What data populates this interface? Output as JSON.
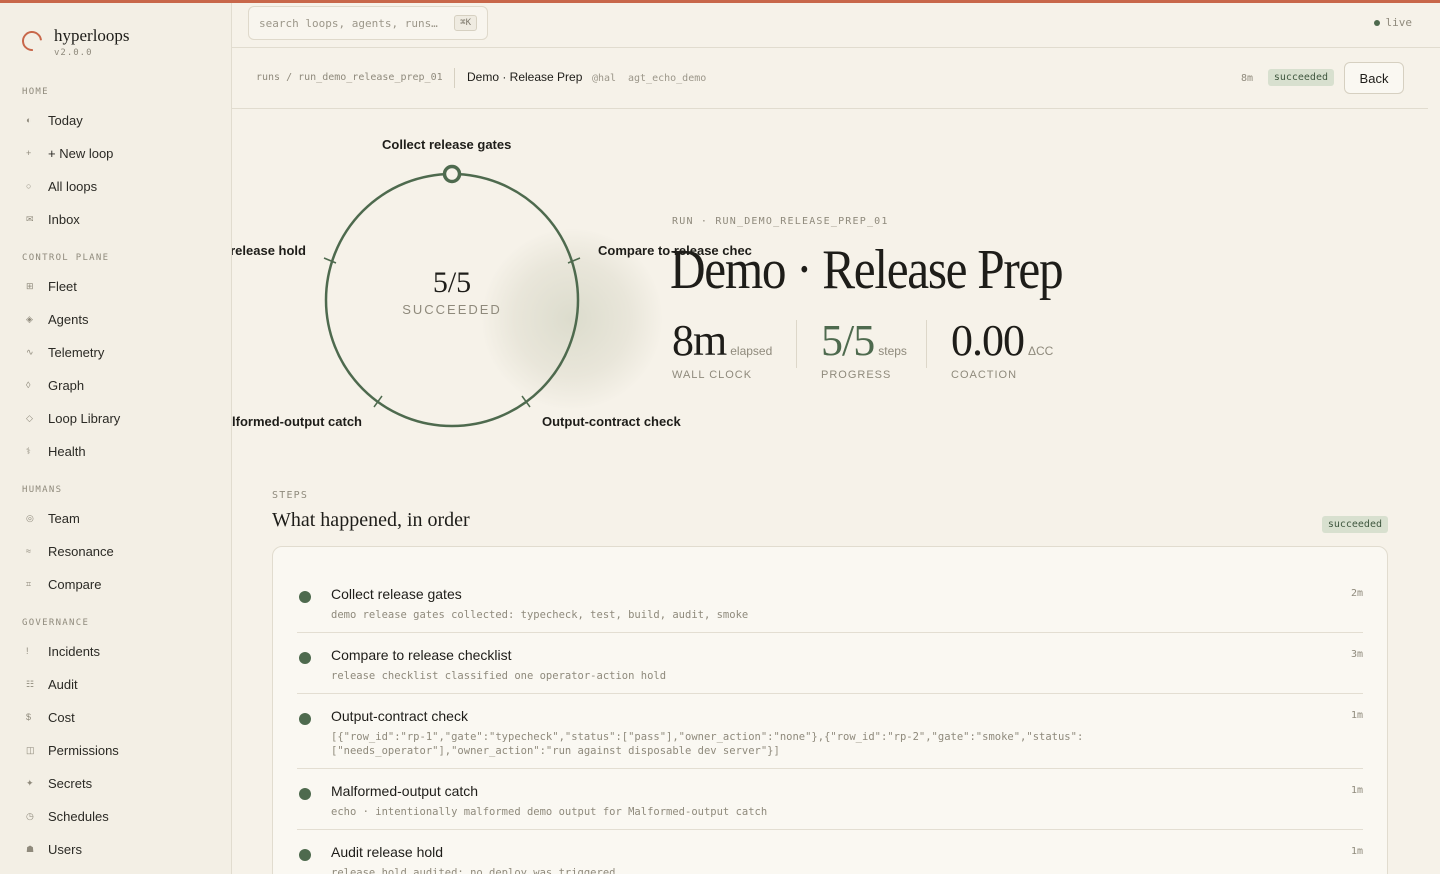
{
  "app": {
    "name": "hyperloops",
    "version": "v2.0.0"
  },
  "search": {
    "placeholder": "search loops, agents, runs…",
    "shortcut": "⌘K"
  },
  "status": {
    "live": "live"
  },
  "sidebar": {
    "sections": [
      {
        "label": "HOME",
        "items": [
          {
            "glyph": "◐",
            "label": "Today"
          },
          {
            "glyph": "+",
            "label": "+ New loop"
          },
          {
            "glyph": "○",
            "label": "All loops"
          },
          {
            "glyph": "✉",
            "label": "Inbox"
          }
        ]
      },
      {
        "label": "CONTROL PLANE",
        "items": [
          {
            "glyph": "⊞",
            "label": "Fleet"
          },
          {
            "glyph": "◈",
            "label": "Agents"
          },
          {
            "glyph": "∿",
            "label": "Telemetry"
          },
          {
            "glyph": "◊",
            "label": "Graph"
          },
          {
            "glyph": "◇",
            "label": "Loop Library"
          },
          {
            "glyph": "⚕",
            "label": "Health"
          }
        ]
      },
      {
        "label": "HUMANS",
        "items": [
          {
            "glyph": "◎",
            "label": "Team"
          },
          {
            "glyph": "≈",
            "label": "Resonance"
          },
          {
            "glyph": "⌗",
            "label": "Compare"
          }
        ]
      },
      {
        "label": "GOVERNANCE",
        "items": [
          {
            "glyph": "!",
            "label": "Incidents"
          },
          {
            "glyph": "☷",
            "label": "Audit"
          },
          {
            "glyph": "$",
            "label": "Cost"
          },
          {
            "glyph": "◫",
            "label": "Permissions"
          },
          {
            "glyph": "✦",
            "label": "Secrets"
          },
          {
            "glyph": "◷",
            "label": "Schedules"
          },
          {
            "glyph": "☗",
            "label": "Users"
          }
        ]
      }
    ]
  },
  "header": {
    "crumbs": [
      "runs",
      "run_demo_release_prep_01"
    ],
    "title": "Demo · Release Prep",
    "owner": "@hal",
    "agent": "agt_echo_demo",
    "duration": "8m",
    "status": "succeeded",
    "back_label": "Back"
  },
  "ring": {
    "count": "5/5",
    "state": "SUCCEEDED",
    "labels": [
      "Collect release gates",
      "Compare to release checklist",
      "Output-contract check",
      "Malformed-output catch",
      "Audit release hold"
    ],
    "completed_fraction": 1.0
  },
  "hero": {
    "eyebrow": "RUN · RUN_DEMO_RELEASE_PREP_01",
    "title": "Demo · Release Prep",
    "stats": [
      {
        "value": "8m",
        "unit": "elapsed",
        "label": "WALL CLOCK"
      },
      {
        "value": "5/5",
        "unit": "steps",
        "label": "PROGRESS"
      },
      {
        "value": "0.00",
        "unit": "ΔCC",
        "label": "COACTION"
      }
    ]
  },
  "steps": {
    "eyebrow": "STEPS",
    "title": "What happened, in order",
    "status": "succeeded",
    "items": [
      {
        "title": "Collect release gates",
        "detail": "demo release gates collected: typecheck, test, build, audit, smoke",
        "duration": "2m"
      },
      {
        "title": "Compare to release checklist",
        "detail": "release checklist classified one operator-action hold",
        "duration": "3m"
      },
      {
        "title": "Output-contract check",
        "detail": "[{\"row_id\":\"rp-1\",\"gate\":\"typecheck\",\"status\":[\"pass\"],\"owner_action\":\"none\"},{\"row_id\":\"rp-2\",\"gate\":\"smoke\",\"status\":[\"needs_operator\"],\"owner_action\":\"run against disposable dev server\"}]",
        "duration": "1m"
      },
      {
        "title": "Malformed-output catch",
        "detail": "echo · intentionally malformed demo output for Malformed-output catch",
        "duration": "1m"
      },
      {
        "title": "Audit release hold",
        "detail": "release hold audited; no deploy was triggered",
        "duration": "1m"
      }
    ]
  },
  "colors": {
    "accent": "#c8674a",
    "success": "#4e6a4e",
    "badge_bg": "#d8e0cf",
    "background": "#f6f2e9"
  }
}
